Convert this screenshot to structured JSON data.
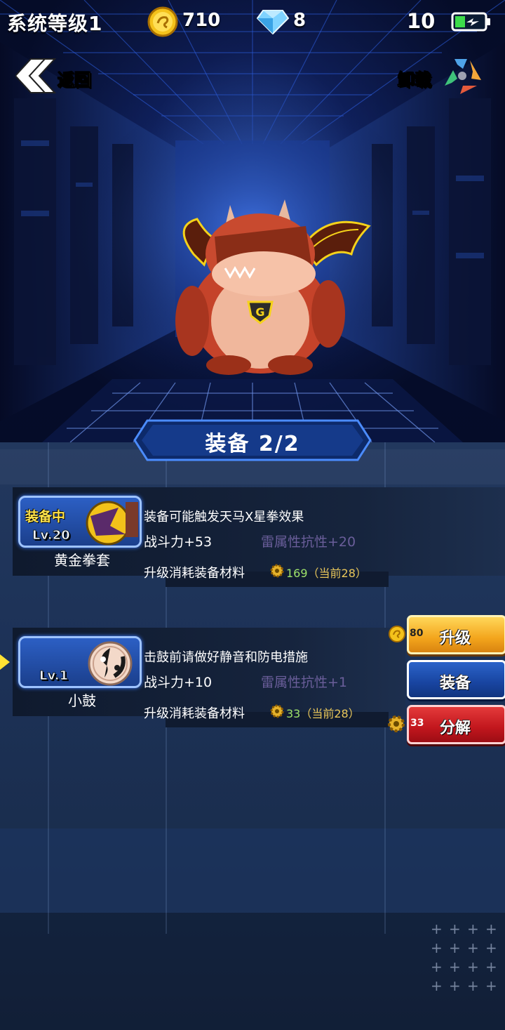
{
  "topbar": {
    "system_level": "系统等级1",
    "coins": "710",
    "gems": "8",
    "energy": "10",
    "icons": [
      "coin-icon",
      "diamond-icon",
      "battery-icon"
    ]
  },
  "nav": {
    "back_label": "返回",
    "unload_label": "卸载",
    "icons": [
      "double-chevron-left-icon",
      "recycle-icon"
    ]
  },
  "equipment_panel": {
    "title": "装备   2/2",
    "items": [
      {
        "status": "装备中",
        "level": "Lv.20",
        "name": "黄金拳套",
        "description": "装备可能触发天马X星拳效果",
        "power": "战斗力+53",
        "resist": "雷属性抗性+20",
        "cost_label": "升级消耗装备材料",
        "cost_value": "169",
        "cost_current": "（当前28）"
      },
      {
        "status": "",
        "level": "Lv.1",
        "name": "小鼓",
        "description": "击鼓前请做好静音和防电措施",
        "power": "战斗力+10",
        "resist": "雷属性抗性+1",
        "cost_label": "升级消耗装备材料",
        "cost_value": "33",
        "cost_current": "（当前28）"
      }
    ]
  },
  "actions": {
    "upgrade": {
      "label": "升级",
      "cost": "80"
    },
    "equip": {
      "label": "装备"
    },
    "decompose": {
      "label": "分解",
      "cost": "33"
    }
  },
  "colors": {
    "upgrade_button": "#f3a51c",
    "equip_button": "#1844a0",
    "decompose_button": "#c1161d",
    "resist_text": "#6a5e9a",
    "cost_text": "#9ee26a"
  }
}
